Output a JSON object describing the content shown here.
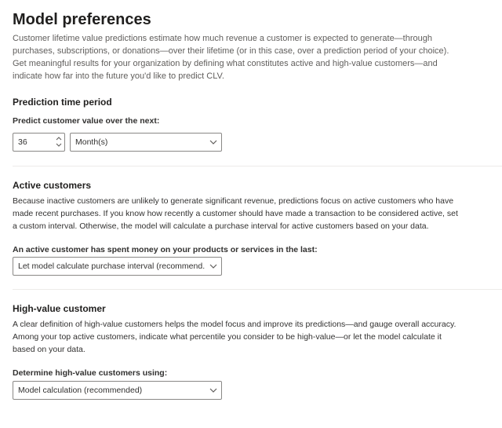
{
  "page": {
    "title": "Model preferences",
    "intro": "Customer lifetime value predictions estimate how much revenue a customer is expected to generate—through purchases, subscriptions, or donations—over their lifetime (or in this case, over a prediction period of your choice). Get meaningful results for your organization by defining what constitutes active and high-value customers—and indicate how far into the future you'd like to predict CLV."
  },
  "prediction": {
    "title": "Prediction time period",
    "label": "Predict customer value over the next:",
    "amount": "36",
    "unit": "Month(s)"
  },
  "active": {
    "title": "Active customers",
    "description": "Because inactive customers are unlikely to generate significant revenue, predictions focus on active customers who have made recent purchases. If you know how recently a customer should have made a transaction to be considered active, set a custom interval. Otherwise, the model will calculate a purchase interval for active customers based on your data.",
    "label": "An active customer has spent money on your products or services in the last:",
    "selected": "Let model calculate purchase interval (recommend..."
  },
  "high_value": {
    "title": "High-value customer",
    "description": "A clear definition of high-value customers helps the model focus and improve its predictions—and gauge overall accuracy. Among your top active customers, indicate what percentile you consider to be high-value—or let the model calculate it based on your data.",
    "label": "Determine high-value customers using:",
    "selected": "Model calculation (recommended)"
  }
}
